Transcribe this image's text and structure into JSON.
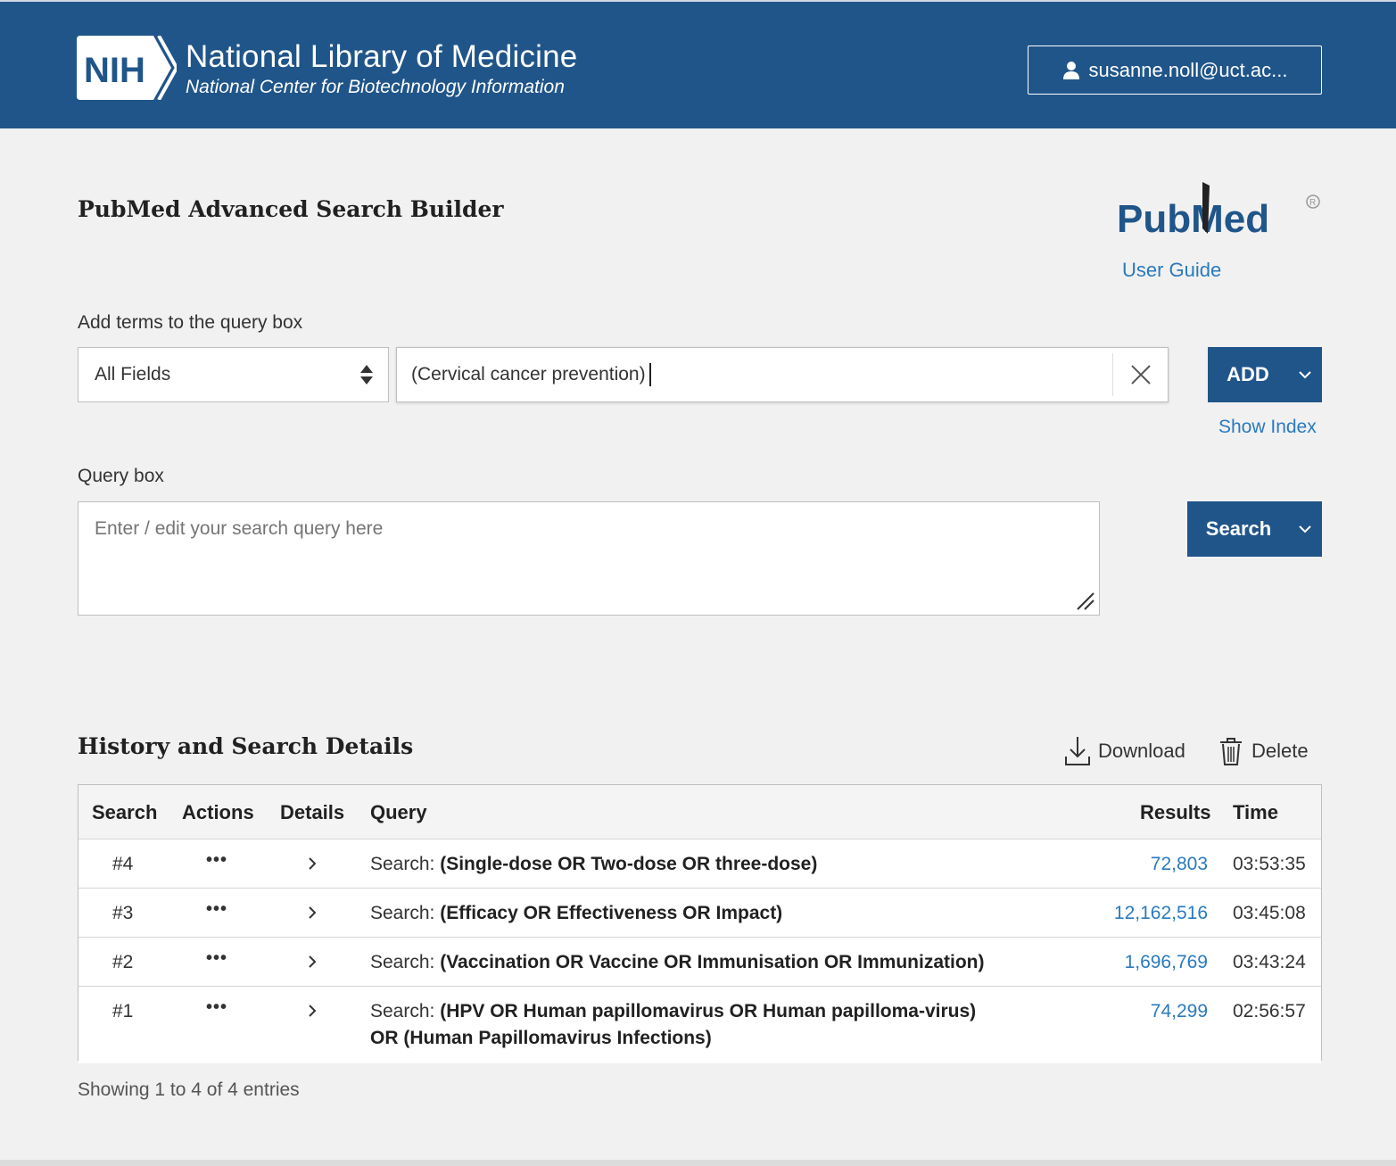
{
  "header": {
    "logo_text": "NIH",
    "title": "National Library of Medicine",
    "subtitle": "National Center for Biotechnology Information",
    "account_label": "susanne.noll@uct.ac..."
  },
  "page": {
    "title": "PubMed Advanced Search Builder",
    "pubmed_logo": "PubMed",
    "user_guide": "User Guide"
  },
  "add_terms": {
    "label": "Add terms to the query box",
    "field_value": "All Fields",
    "term_value": "(Cervical cancer prevention)",
    "add_label": "ADD",
    "show_index": "Show Index"
  },
  "query": {
    "label": "Query box",
    "placeholder": "Enter / edit your search query here",
    "search_label": "Search"
  },
  "history": {
    "title": "History and Search Details",
    "download_label": "Download",
    "delete_label": "Delete",
    "columns": [
      "Search",
      "Actions",
      "Details",
      "Query",
      "Results",
      "Time"
    ],
    "rows": [
      {
        "num": "#4",
        "actions": "•••",
        "prefix": "Search: ",
        "query": "(Single-dose OR Two-dose OR three-dose)",
        "query2": "",
        "results": "72,803",
        "time": "03:53:35"
      },
      {
        "num": "#3",
        "actions": "•••",
        "prefix": "Search: ",
        "query": "(Efficacy OR Effectiveness OR Impact)",
        "query2": "",
        "results": "12,162,516",
        "time": "03:45:08"
      },
      {
        "num": "#2",
        "actions": "•••",
        "prefix": "Search: ",
        "query": "(Vaccination OR Vaccine OR Immunisation OR Immunization)",
        "query2": "",
        "results": "1,696,769",
        "time": "03:43:24"
      },
      {
        "num": "#1",
        "actions": "•••",
        "prefix": "Search: ",
        "query": "(HPV OR Human papillomavirus OR Human papilloma-virus)",
        "query2": "OR (Human Papillomavirus Infections)",
        "results": "74,299",
        "time": "02:56:57"
      }
    ],
    "footer": "Showing 1 to 4 of 4 entries"
  },
  "colors": {
    "header_bg": "#20558a",
    "button_bg": "#20558a",
    "link": "#2a7abf",
    "page_bg": "#f1f1f1"
  },
  "icons": [
    "user-icon",
    "sort-icon",
    "close-icon",
    "chevron-down-icon",
    "download-icon",
    "trash-icon",
    "chevron-right-icon",
    "resize-grip-icon"
  ]
}
